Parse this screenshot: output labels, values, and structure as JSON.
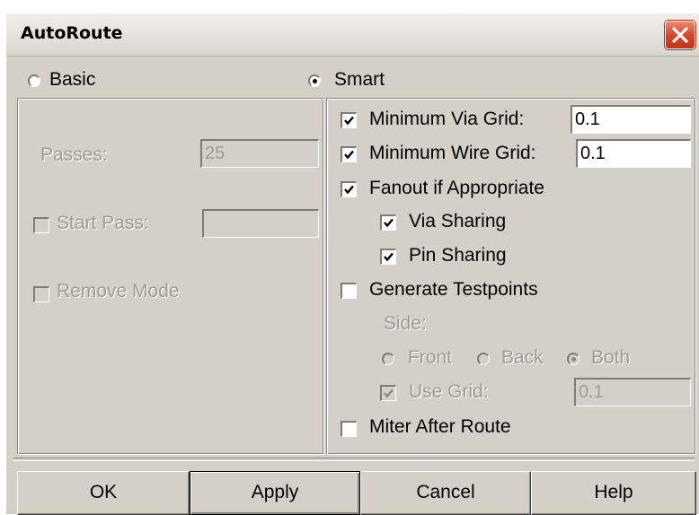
{
  "window": {
    "title": "AutoRoute"
  },
  "mode": {
    "basic_label": "Basic",
    "smart_label": "Smart",
    "selected": "Smart"
  },
  "basic": {
    "passes_label": "Passes:",
    "passes_value": "25",
    "start_pass_label": "Start Pass:",
    "start_pass_value": "",
    "remove_mode_label": "Remove Mode"
  },
  "smart": {
    "min_via_grid_label": "Minimum Via Grid:",
    "min_via_grid_value": "0.1",
    "min_via_grid_checked": true,
    "min_wire_grid_label": "Minimum Wire Grid:",
    "min_wire_grid_value": "0.1",
    "min_wire_grid_checked": true,
    "fanout_label": "Fanout if Appropriate",
    "fanout_checked": true,
    "via_sharing_label": "Via Sharing",
    "via_sharing_checked": true,
    "pin_sharing_label": "Pin Sharing",
    "pin_sharing_checked": true,
    "gen_testpoints_label": "Generate Testpoints",
    "gen_testpoints_checked": false,
    "side_label": "Side:",
    "side_front_label": "Front",
    "side_back_label": "Back",
    "side_both_label": "Both",
    "side_selected": "Both",
    "use_grid_label": "Use Grid:",
    "use_grid_checked": true,
    "use_grid_value": "0.1",
    "miter_label": "Miter After Route",
    "miter_checked": false
  },
  "buttons": {
    "ok": "OK",
    "apply": "Apply",
    "cancel": "Cancel",
    "help": "Help"
  },
  "icons": {
    "close": "close-icon",
    "check": "checkmark-icon"
  },
  "colors": {
    "face": "#d4d0c8",
    "close_red": "#d9472b",
    "disabled_text": "#a09c94"
  }
}
